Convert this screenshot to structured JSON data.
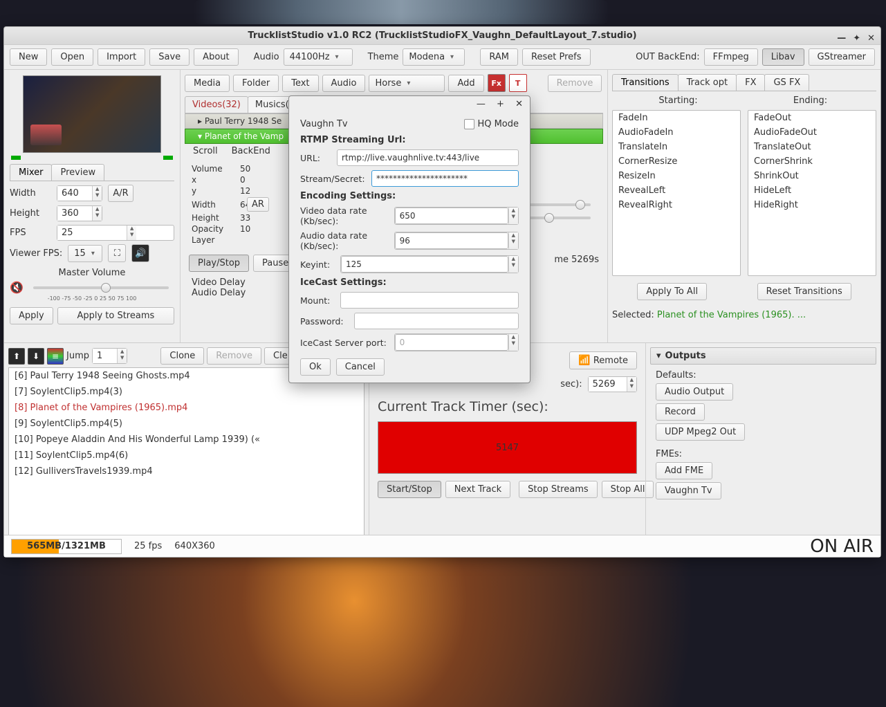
{
  "window_title": "TrucklistStudio v1.0 RC2 (TrucklistStudioFX_Vaughn_DefaultLayout_7.studio)",
  "toolbar": {
    "new": "New",
    "open": "Open",
    "import": "Import",
    "save": "Save",
    "about": "About",
    "audio_lbl": "Audio",
    "audio_val": "44100Hz",
    "theme_lbl": "Theme",
    "theme_val": "Modena",
    "ram": "RAM",
    "reset": "Reset Prefs",
    "backend_lbl": "OUT BackEnd:",
    "ffmpeg": "FFmpeg",
    "libav": "Libav",
    "gstreamer": "GStreamer"
  },
  "left": {
    "mixer": "Mixer",
    "preview": "Preview",
    "width_lbl": "Width",
    "width": "640",
    "height_lbl": "Height",
    "height": "360",
    "ar": "A/R",
    "fps_lbl": "FPS",
    "fps": "25",
    "viewer_fps_lbl": "Viewer FPS:",
    "viewer_fps": "15",
    "master_vol": "Master Volume",
    "scale": "-100 -75 -50 -25 0 25 50 75 100",
    "apply": "Apply",
    "apply_streams": "Apply to Streams"
  },
  "center": {
    "media": "Media",
    "folder": "Folder",
    "text": "Text",
    "audio": "Audio",
    "animal": "Horse",
    "add": "Add",
    "remove": "Remove",
    "tab_videos": "Videos(32)",
    "tab_musics": "Musics(",
    "t1": "▸  Paul Terry 1948 Se",
    "t2": "▾  Planet of the Vamp",
    "scroll": "Scroll",
    "backend": "BackEnd",
    "volume": "Volume",
    "vol_v": "50",
    "x": "x",
    "x_v": "0",
    "y": "y",
    "y_v": "12",
    "width": "Width",
    "w_v": "64",
    "height": "Height",
    "h_v": "33",
    "opacity": "Opacity",
    "o_v": "10",
    "layer": "Layer",
    "ar": "AR",
    "play": "Play/Stop",
    "pause": "Pause",
    "time_right": "me 5269s",
    "vdelay": "Video Delay",
    "adelay": "Audio Delay"
  },
  "right": {
    "transitions": "Transitions",
    "trackopt": "Track opt",
    "fx": "FX",
    "gsfx": "GS FX",
    "starting": "Starting:",
    "ending": "Ending:",
    "start_list": [
      "FadeIn",
      "AudioFadeIn",
      "TranslateIn",
      "CornerResize",
      "ResizeIn",
      "RevealLeft",
      "RevealRight"
    ],
    "end_list": [
      "FadeOut",
      "AudioFadeOut",
      "TranslateOut",
      "CornerShrink",
      "ShrinkOut",
      "HideLeft",
      "HideRight"
    ],
    "apply_all": "Apply To All",
    "reset_trans": "Reset Transitions",
    "sel_lbl": "Selected:",
    "sel_val": "Planet of the Vampires (1965). ..."
  },
  "playlist": {
    "jump": "Jump",
    "jump_v": "1",
    "clone": "Clone",
    "remove": "Remove",
    "cle": "Cle",
    "items": [
      "[6] Paul Terry 1948 Seeing Ghosts.mp4",
      "[7] SoylentClip5.mp4(3)",
      "[8] Planet of the Vampires (1965).mp4",
      "[9] SoylentClip5.mp4(5)",
      "[10] Popeye Aladdin And His Wonderful Lamp 1939) («",
      "[11] SoylentClip5.mp4(6)",
      "[12] GulliversTravels1939.mp4"
    ],
    "selected": 2
  },
  "timer": {
    "remote": "Remote",
    "sec_lbl": "sec):",
    "dur_v": "5269",
    "cur_lbl": "Current Track Timer (sec):",
    "cur_v": "5147",
    "start": "Start/Stop",
    "next": "Next Track",
    "stop_streams": "Stop Streams",
    "stop_all": "Stop All"
  },
  "outputs": {
    "title": "Outputs",
    "defaults": "Defaults:",
    "audio_out": "Audio Output",
    "record": "Record",
    "udp": "UDP Mpeg2 Out",
    "fmes": "FMEs:",
    "add_fme": "Add FME",
    "vaughn": "Vaughn Tv"
  },
  "status": {
    "mem": "565MB/1321MB",
    "fps": "25 fps",
    "res": "640X360",
    "onair": "ON AIR"
  },
  "dialog": {
    "title": "Vaughn Tv",
    "hq": "HQ Mode",
    "rtmp_h": "RTMP Streaming Url:",
    "url_lbl": "URL:",
    "url": "rtmp://live.vaughnlive.tv:443/live",
    "secret_lbl": "Stream/Secret:",
    "secret": "**********************",
    "enc_h": "Encoding Settings:",
    "vrate_lbl": "Video data rate (Kb/sec):",
    "vrate": "650",
    "arate_lbl": "Audio data rate (Kb/sec):",
    "arate": "96",
    "keyint_lbl": "Keyint:",
    "keyint": "125",
    "ice_h": "IceCast Settings:",
    "mount": "Mount:",
    "pass": "Password:",
    "iceport_lbl": "IceCast Server port:",
    "iceport": "0",
    "ok": "Ok",
    "cancel": "Cancel"
  }
}
